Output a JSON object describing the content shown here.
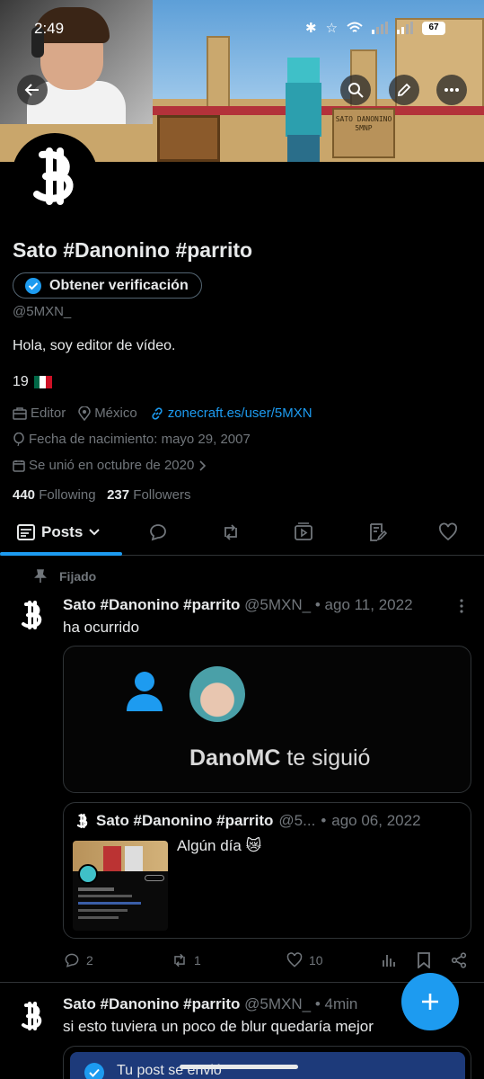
{
  "status_bar": {
    "time": "2:49",
    "battery": "67"
  },
  "profile": {
    "display_name": "Sato #Danonino #parrito",
    "verify_button": "Obtener verificación",
    "handle": "@5MXN_",
    "bio": "Hola, soy editor de vídeo.",
    "age": "19",
    "category": "Editor",
    "location": "México",
    "website": "zonecraft.es/user/5MXN",
    "birthday": "Fecha de nacimiento: mayo 29, 2007",
    "joined": "Se unió en octubre de 2020",
    "following_count": "440",
    "following_label": "Following",
    "followers_count": "237",
    "followers_label": "Followers"
  },
  "banner": {
    "sign_text": "SATO DANONINO 5MNP"
  },
  "tabs": {
    "posts_label": "Posts"
  },
  "pinned_post": {
    "pinned_label": "Fijado",
    "author": "Sato #Danonino #parrito",
    "handle": "@5MXN_",
    "date": "ago 11, 2022",
    "text": "ha ocurrido",
    "media": {
      "follower_name": "DanoMC",
      "follow_text": "te siguió"
    },
    "quote": {
      "author": "Sato #Danonino #parrito",
      "handle": "@5...",
      "date": "ago 06, 2022",
      "text": "Algún día 😿"
    },
    "replies": "2",
    "reposts": "1",
    "likes": "10"
  },
  "second_post": {
    "author": "Sato #Danonino #parrito",
    "handle": "@5MXN_",
    "time": "4min",
    "text": "si esto tuviera un poco de blur quedaría mejor"
  },
  "toast": {
    "text": "Tu post se envió"
  },
  "colors": {
    "accent": "#1d9bf0",
    "background": "#000000",
    "muted": "#71767b"
  }
}
